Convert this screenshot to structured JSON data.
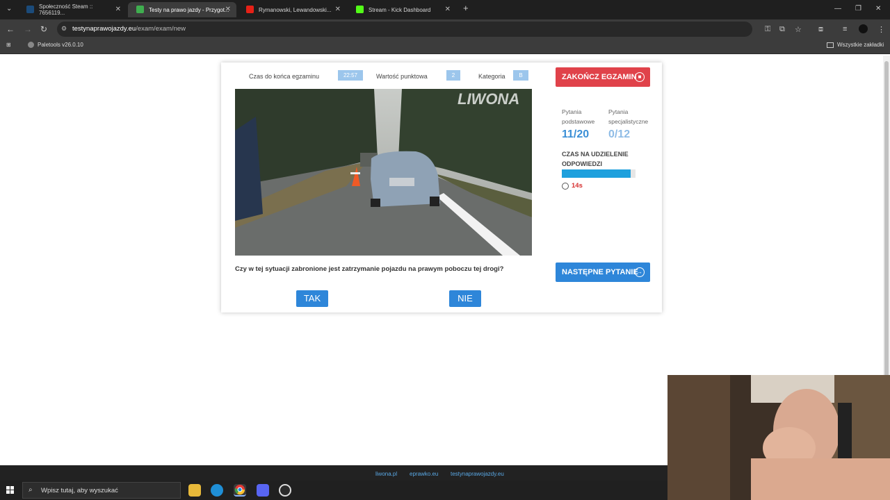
{
  "browser": {
    "tabs": [
      {
        "title": "Społeczność Steam :: 7656119...",
        "icon": "steam-icon",
        "active": false
      },
      {
        "title": "Testy na prawo jazdy - Przygot...",
        "icon": "page-icon",
        "active": true
      },
      {
        "title": "Rymanowski, Lewandowski...",
        "icon": "youtube-icon",
        "active": false
      },
      {
        "title": "Stream - Kick Dashboard",
        "icon": "kick-icon",
        "active": false
      }
    ],
    "url_host": "testynaprawojazdy.eu",
    "url_path": "/exam/exam/new",
    "bookmark": "Paletools v26.0.10",
    "all_bookmarks": "Wszystkie zakładki"
  },
  "exam": {
    "time_label": "Czas do końca egzaminu",
    "time_value": "22:57",
    "points_label": "Wartość punktowa",
    "points_value": "2",
    "category_label": "Kategoria",
    "category_value": "B",
    "end_button": "ZAKOŃCZ EGZAMIN",
    "basic_label_1": "Pytania",
    "basic_label_2": "podstawowe",
    "basic_count": "11/20",
    "special_label_1": "Pytania",
    "special_label_2": "specjalistyczne",
    "special_count": "0/12",
    "answer_time_label": "CZAS NA UDZIELENIE ODPOWIEDZI",
    "answer_time_fraction": 0.93,
    "answer_time_value": "14s",
    "photo_watermark": "LIWONA",
    "question": "Czy w tej sytuacji zabronione jest zatrzymanie pojazdu na prawym poboczu tej drogi?",
    "yes": "TAK",
    "no": "NIE",
    "next_button": "NASTĘPNE PYTANIE"
  },
  "footer_links": [
    "liwona.pl",
    "eprawko.eu",
    "testynaprawojazdy.eu"
  ],
  "taskbar": {
    "search_placeholder": "Wpisz tutaj, aby wyszukać"
  },
  "colors": {
    "primary": "#2e86d9",
    "danger": "#e0424a",
    "progress": "#1ea0dd"
  }
}
